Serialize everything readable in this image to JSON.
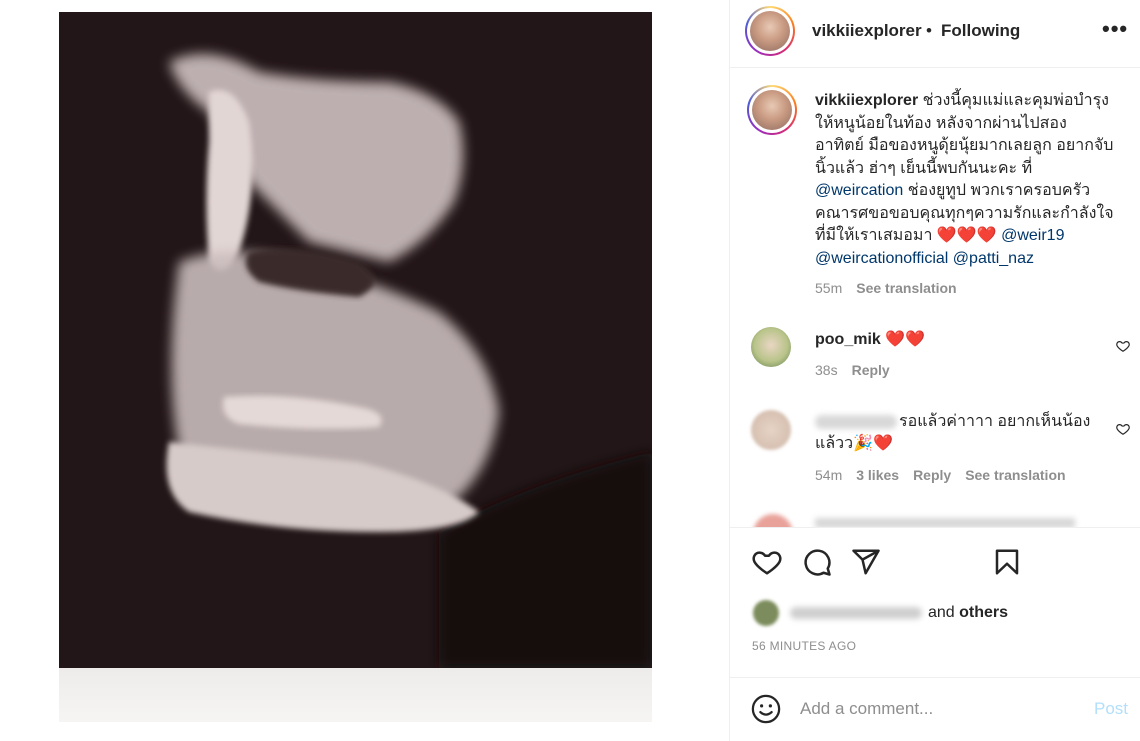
{
  "header": {
    "username": "vikkiiexplorer",
    "separator": "•",
    "follow_status": "Following",
    "more": "•••"
  },
  "caption": {
    "username": "vikkiiexplorer",
    "text_1": "ช่วงนี้คุมแม่และคุมพ่อบำรุงให้หนูน้อยในท้อง หลังจากผ่านไปสองอาทิตย์ มือของหนูดุ้ยนุ้ยมากเลยลูก อยากจับนิ้วแล้ว ฮ่าๆ เย็นนี้พบกันนะคะ ที่ ",
    "mention_1": "@weircation",
    "text_2": " ช่องยูทูป พวกเราครอบครัวคณารศขอขอบคุณทุกๆความรักและกำลังใจที่มีให้เราเสมอมา ",
    "hearts": "❤️❤️❤️",
    "mention_2": "@weir19",
    "mention_3": "@weircationofficial",
    "mention_4": "@patti_naz",
    "time": "55m",
    "see_translation": "See translation"
  },
  "comments": [
    {
      "username": "poo_mik",
      "text": "❤️❤️",
      "time": "38s",
      "reply": "Reply"
    },
    {
      "text": "รอแล้วค่าาาา อยากเห็นน้องแล้วว🎉❤️",
      "time": "54m",
      "likes": "3 likes",
      "reply": "Reply",
      "see_translation": "See translation"
    }
  ],
  "likes": {
    "suffix_and": "and",
    "suffix_others": "others"
  },
  "timestamp": "56 MINUTES AGO",
  "add_comment": {
    "placeholder": "Add a comment...",
    "post_label": "Post"
  },
  "colors": {
    "link": "#00376b",
    "meta_gray": "#8e8e8e",
    "post_disabled": "#b2dffc",
    "heart_red": "#ed1c24"
  }
}
